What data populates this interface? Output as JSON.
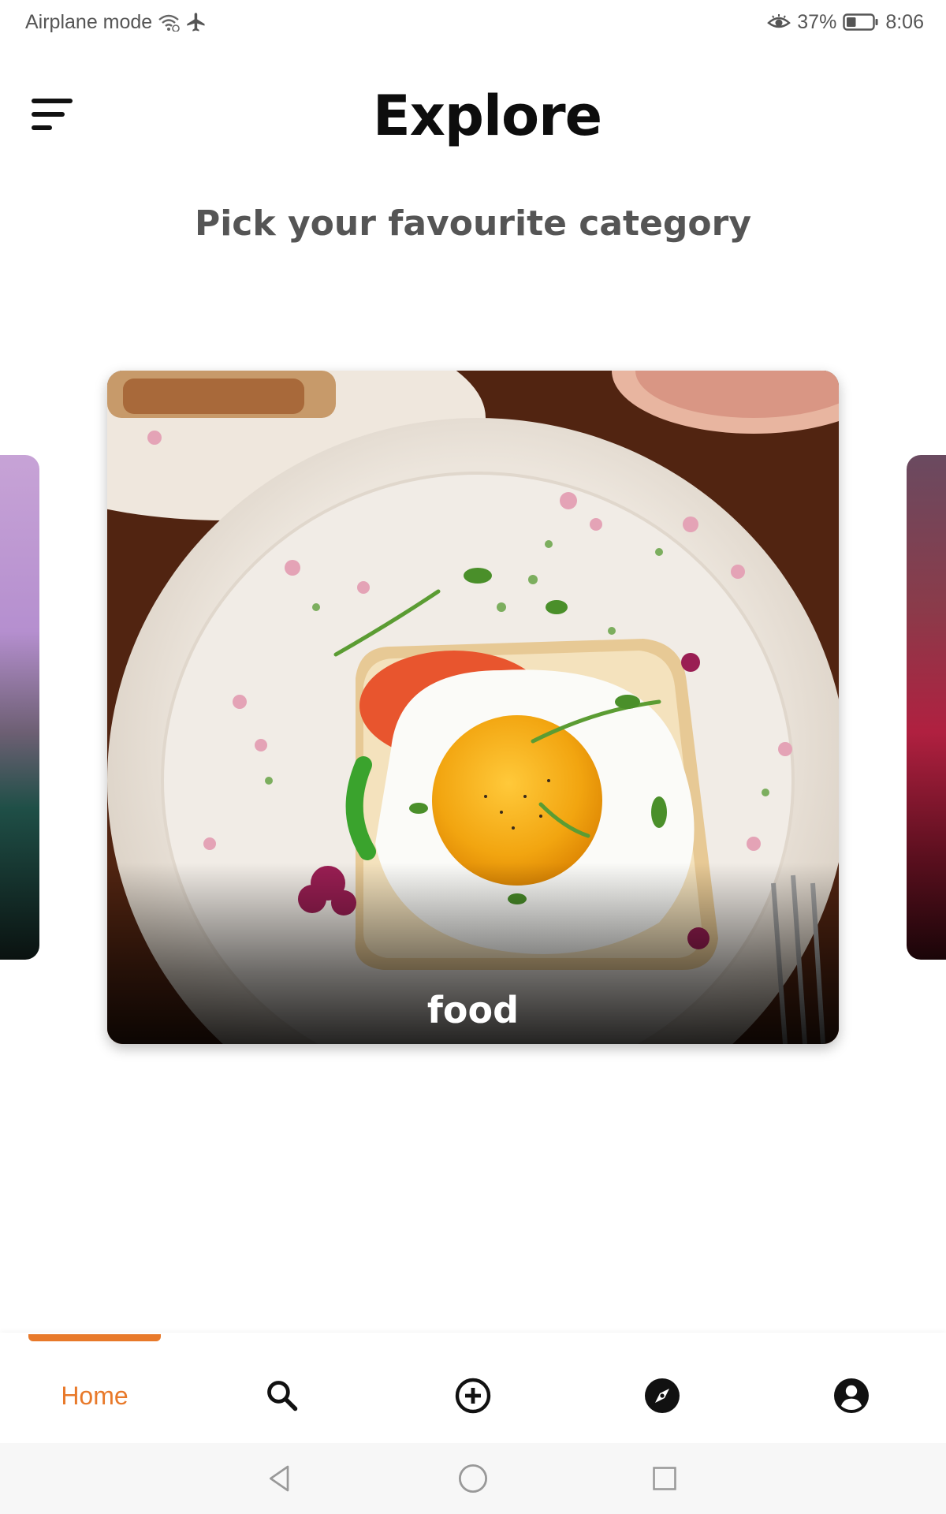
{
  "status_bar": {
    "airplane_mode_label": "Airplane mode",
    "battery_percent": "37%",
    "battery_level": 0.37,
    "time": "8:06",
    "icons": [
      "wifi-icon",
      "airplane-icon",
      "eye-icon",
      "battery-icon"
    ]
  },
  "header": {
    "title": "Explore",
    "subtitle": "Pick your favourite category",
    "menu_icon": "menu-icon"
  },
  "carousel": {
    "current_card": {
      "label": "food"
    },
    "previous_card": {
      "label": ""
    },
    "next_card": {
      "label": ""
    }
  },
  "bottom_nav": {
    "items": [
      {
        "label": "Home",
        "icon": "home",
        "active": true
      },
      {
        "label": "",
        "icon": "search-icon",
        "active": false
      },
      {
        "label": "",
        "icon": "add-circle-icon",
        "active": false
      },
      {
        "label": "",
        "icon": "compass-icon",
        "active": false
      },
      {
        "label": "",
        "icon": "profile-icon",
        "active": false
      }
    ],
    "accent_color": "#e8792a"
  },
  "system_nav": {
    "icons": [
      "back-icon",
      "home-circle-icon",
      "recents-icon"
    ]
  }
}
